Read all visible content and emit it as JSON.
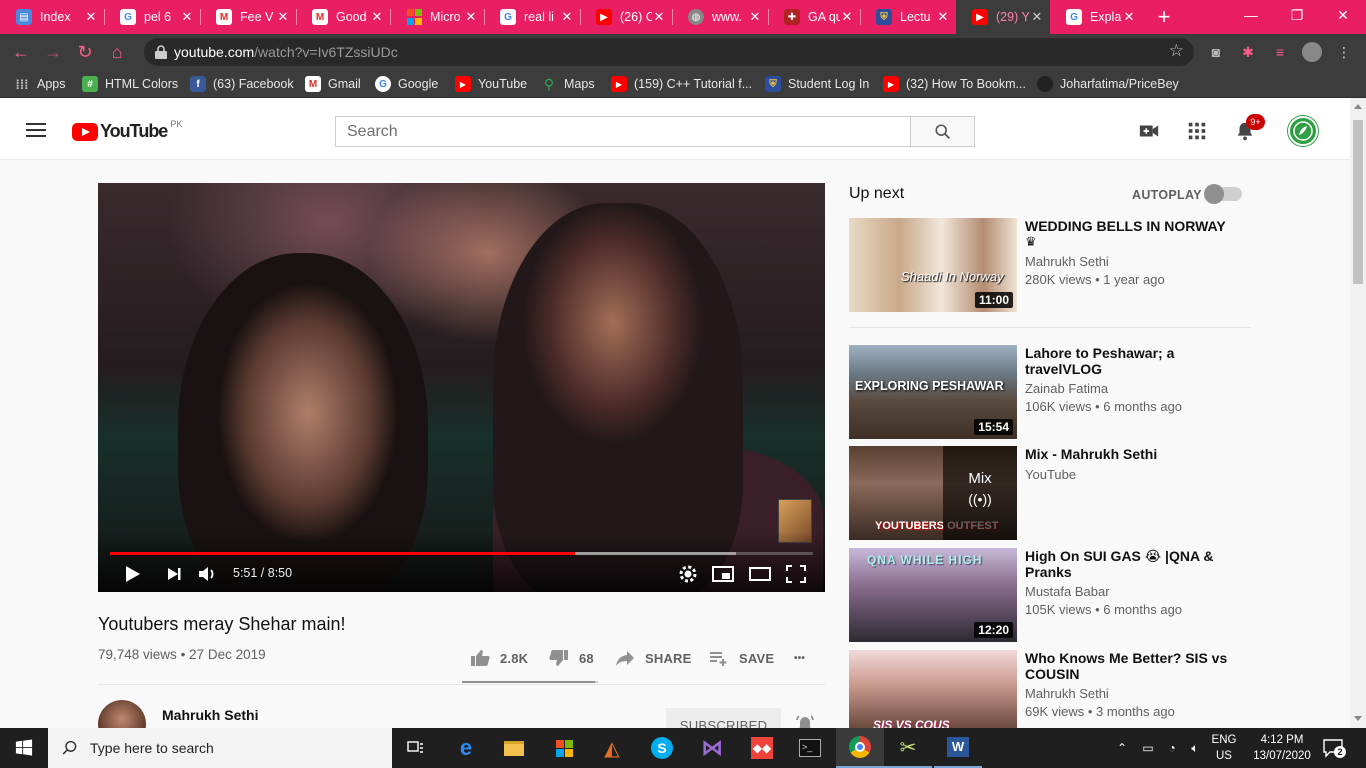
{
  "browser": {
    "tabs": [
      {
        "label": "Index",
        "icon": "doc-icon",
        "color": "#4a89dc"
      },
      {
        "label": "pel 6",
        "icon": "google-icon",
        "color": "#ffffff"
      },
      {
        "label": "Fee V",
        "icon": "gmail-icon",
        "color": "#ffffff"
      },
      {
        "label": "Good",
        "icon": "gmail-icon",
        "color": "#ffffff"
      },
      {
        "label": "Micro",
        "icon": "microsoft-icon",
        "color": "#ffffff"
      },
      {
        "label": "real li",
        "icon": "google-icon",
        "color": "#ffffff"
      },
      {
        "label": "(26) C",
        "icon": "youtube-icon",
        "color": "#ff0000"
      },
      {
        "label": "www.",
        "icon": "globe-icon",
        "color": "#888888"
      },
      {
        "label": "GA qu",
        "icon": "shield-icon",
        "color": "#b22222"
      },
      {
        "label": "Lectu",
        "icon": "uni-icon",
        "color": "#2b4f9c"
      },
      {
        "label": "(29) Y",
        "icon": "youtube-icon",
        "color": "#ff0000"
      },
      {
        "label": "Explai",
        "icon": "google-icon",
        "color": "#ffffff"
      }
    ],
    "active_tab_index": 10,
    "new_tab": "+",
    "url_host": "youtube.com",
    "url_path": "/watch?v=Iv6TZssiUDc",
    "bookmarks": [
      {
        "label": "Apps",
        "icon": "apps-grid-icon"
      },
      {
        "label": "HTML Colors",
        "icon": "html-colors-icon"
      },
      {
        "label": "(63) Facebook",
        "icon": "facebook-icon"
      },
      {
        "label": "Gmail",
        "icon": "gmail-icon"
      },
      {
        "label": "Google",
        "icon": "google-icon"
      },
      {
        "label": "YouTube",
        "icon": "youtube-icon"
      },
      {
        "label": "Maps",
        "icon": "maps-pin-icon"
      },
      {
        "label": "(159) C++ Tutorial f...",
        "icon": "youtube-icon"
      },
      {
        "label": "Student Log In",
        "icon": "uni-icon"
      },
      {
        "label": "(32) How To Bookm...",
        "icon": "youtube-icon"
      },
      {
        "label": "Joharfatima/PriceBey",
        "icon": "github-icon"
      }
    ]
  },
  "youtube": {
    "logo_word": "YouTube",
    "region": "PK",
    "search_placeholder": "Search",
    "notifications_badge": "9+",
    "player": {
      "current_time": "5:51",
      "duration": "8:50",
      "time_display": "5:51 / 8:50",
      "played_fraction": 0.662,
      "buffered_fraction": 0.89
    },
    "video": {
      "title": "Youtubers meray Shehar main!",
      "views": "79,748 views",
      "date": "27 Dec 2019",
      "likes": "2.8K",
      "dislikes": "68",
      "like_fraction": 0.976,
      "share_label": "SHARE",
      "save_label": "SAVE",
      "more_label": "•••"
    },
    "channel": {
      "name": "Mahrukh Sethi",
      "subscribe_label": "SUBSCRIBED"
    },
    "sidebar": {
      "up_next_label": "Up next",
      "autoplay_label": "AUTOPLAY",
      "autoplay_on": false,
      "items": [
        {
          "title": "WEDDING BELLS IN NORWAY",
          "title_icon": "crown-emoji-icon",
          "channel": "Mahrukh Sethi",
          "views": "280K views • 1 year ago",
          "duration": "11:00",
          "thumb_text": "Shaadi In Norway"
        },
        {
          "title": "Lahore to Peshawar; a travelVLOG",
          "channel": "Zainab Fatima",
          "views": "106K views • 6 months ago",
          "duration": "15:54",
          "thumb_text": "EXPLORING PESHAWAR"
        },
        {
          "title": "Mix - Mahrukh Sethi",
          "channel": "YouTube",
          "views": "",
          "mix_label": "Mix",
          "thumb_text": "YOUTUBERS OUTFEST"
        },
        {
          "title": "High On SUI GAS 😭 |QNA & Pranks",
          "channel": "Mustafa Babar",
          "views": "105K views • 6 months ago",
          "duration": "12:20",
          "thumb_text": "QNA WHILE HIGH"
        },
        {
          "title": "Who Knows Me Better? SIS vs COUSIN",
          "channel": "Mahrukh Sethi",
          "views": "69K views • 3 months ago",
          "duration": "",
          "thumb_text": "SIS VS COUS"
        }
      ]
    }
  },
  "taskbar": {
    "search_placeholder": "Type here to search",
    "lang_line1": "ENG",
    "lang_line2": "US",
    "time": "4:12 PM",
    "date": "13/07/2020",
    "notification_count": "2"
  }
}
